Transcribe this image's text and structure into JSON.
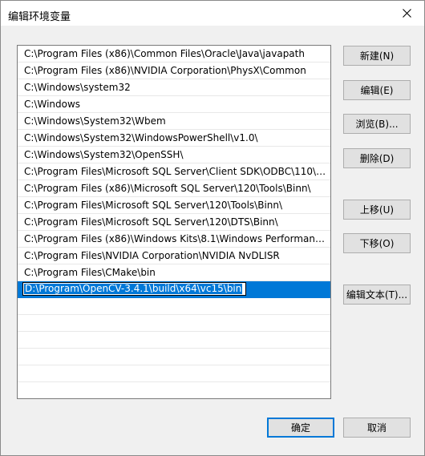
{
  "window": {
    "title": "编辑环境变量"
  },
  "paths": [
    "C:\\Program Files (x86)\\Common Files\\Oracle\\Java\\javapath",
    "C:\\Program Files (x86)\\NVIDIA Corporation\\PhysX\\Common",
    "C:\\Windows\\system32",
    "C:\\Windows",
    "C:\\Windows\\System32\\Wbem",
    "C:\\Windows\\System32\\WindowsPowerShell\\v1.0\\",
    "C:\\Windows\\System32\\OpenSSH\\",
    "C:\\Program Files\\Microsoft SQL Server\\Client SDK\\ODBC\\110\\T...",
    "C:\\Program Files (x86)\\Microsoft SQL Server\\120\\Tools\\Binn\\",
    "C:\\Program Files\\Microsoft SQL Server\\120\\Tools\\Binn\\",
    "C:\\Program Files\\Microsoft SQL Server\\120\\DTS\\Binn\\",
    "C:\\Program Files (x86)\\Windows Kits\\8.1\\Windows Performance...",
    "C:\\Program Files\\NVIDIA Corporation\\NVIDIA NvDLISR",
    "C:\\Program Files\\CMake\\bin"
  ],
  "editing": {
    "value": "D:\\Program\\OpenCV-3.4.1\\build\\x64\\vc15\\bin"
  },
  "buttons": {
    "new": "新建(N)",
    "edit": "编辑(E)",
    "browse": "浏览(B)...",
    "delete": "删除(D)",
    "move_up": "上移(U)",
    "move_down": "下移(O)",
    "edit_text": "编辑文本(T)...",
    "ok": "确定",
    "cancel": "取消"
  },
  "colors": {
    "selection": "#0078d7",
    "default_button_border": "#0078d7"
  }
}
